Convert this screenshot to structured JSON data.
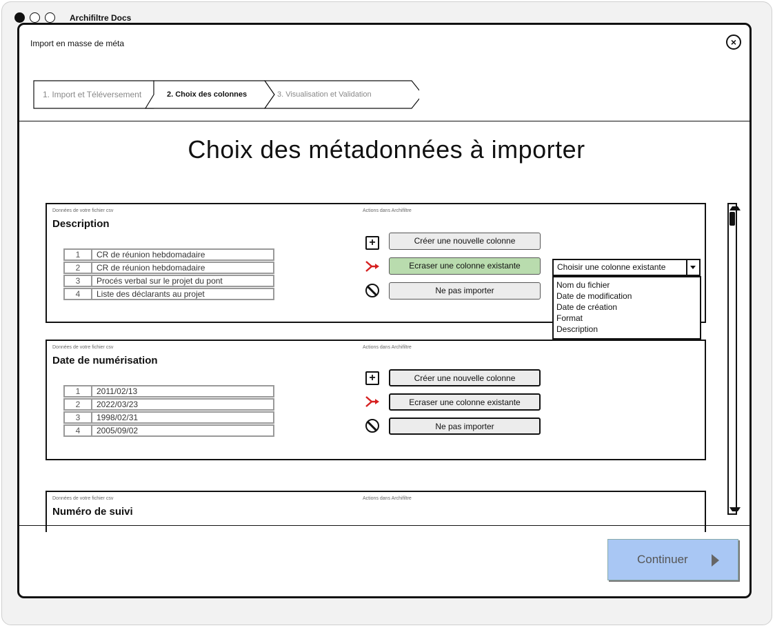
{
  "window": {
    "app_title": "Archifiltre Docs"
  },
  "dialog": {
    "title": "Import en masse de méta",
    "close_icon": "close-icon",
    "steps": [
      {
        "label": "1. Import et Téléversement",
        "state": "done"
      },
      {
        "label": "2. Choix des colonnes",
        "state": "current"
      },
      {
        "label": "3. Visualisation et Validation",
        "state": "pending"
      }
    ],
    "heading": "Choix des métadonnées à importer",
    "csv_label": "Données de votre fichier csv",
    "actions_label": "Actions dans Archifiltre",
    "panels": [
      {
        "field": "Description",
        "rows": [
          {
            "n": "1",
            "v": "CR de réunion hebdomadaire"
          },
          {
            "n": "2",
            "v": "CR de réunion hebdomadaire"
          },
          {
            "n": "3",
            "v": "Procés verbal sur le projet du pont"
          },
          {
            "n": "4",
            "v": "Liste des déclarants au projet"
          }
        ],
        "actions": {
          "create": "Créer une nouvelle colonne",
          "overwrite": "Ecraser une colonne existante",
          "skip": "Ne pas importer"
        },
        "selected_action": "overwrite",
        "select_placeholder": "Choisir une colonne existante",
        "dropdown_options": [
          "Nom du fichier",
          "Date de modification",
          "Date de création",
          "Format",
          "Description"
        ]
      },
      {
        "field": "Date de numérisation",
        "rows": [
          {
            "n": "1",
            "v": "2011/02/13"
          },
          {
            "n": "2",
            "v": "2022/03/23"
          },
          {
            "n": "3",
            "v": "1998/02/31"
          },
          {
            "n": "4",
            "v": "2005/09/02"
          }
        ],
        "actions": {
          "create": "Créer une nouvelle colonne",
          "overwrite": "Ecraser une colonne existante",
          "skip": "Ne pas importer"
        }
      },
      {
        "field": "Numéro de suivi"
      }
    ],
    "continue_label": "Continuer",
    "colors": {
      "selected_action": "#b9dcae",
      "primary_disabled": "#a9c7f4",
      "overwrite_icon": "#d62020"
    }
  }
}
